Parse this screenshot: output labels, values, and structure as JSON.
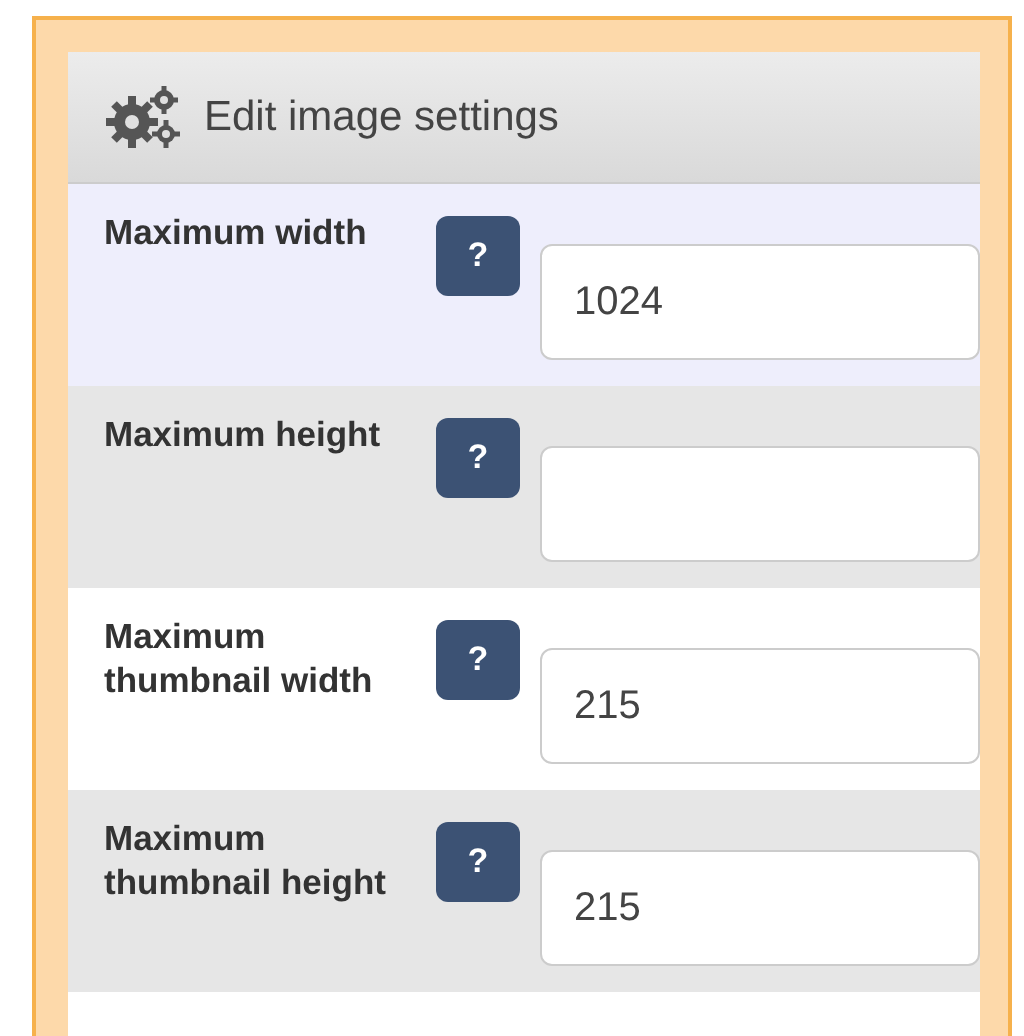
{
  "panel": {
    "title": "Edit image settings"
  },
  "fields": [
    {
      "label": "Maximum width",
      "help": "?",
      "value": "1024",
      "highlighted": true
    },
    {
      "label": "Maximum height",
      "help": "?",
      "highlighted": false
    },
    {
      "label": "Maximum thumbnail width",
      "help": "?",
      "value": "215",
      "highlighted": false
    },
    {
      "label": "Maximum thumbnail height",
      "help": "?",
      "value": "215",
      "highlighted": false
    }
  ]
}
